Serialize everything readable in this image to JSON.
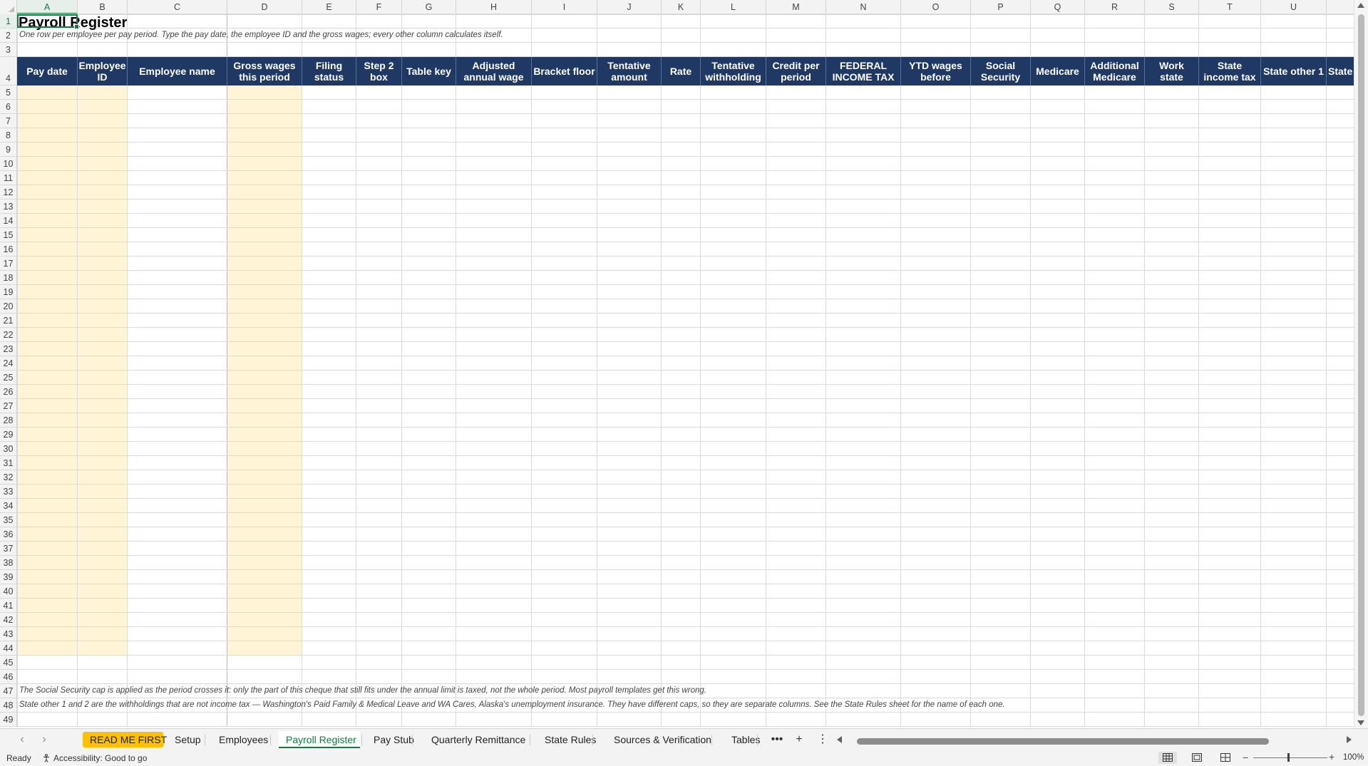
{
  "sheet": {
    "columns": [
      "A",
      "B",
      "C",
      "D",
      "E",
      "F",
      "G",
      "H",
      "I",
      "J",
      "K",
      "L",
      "M",
      "N",
      "O",
      "P",
      "Q",
      "R",
      "S",
      "T",
      "U",
      ""
    ],
    "active_column": "A",
    "rows": [
      "1",
      "2",
      "3",
      "4",
      "5",
      "6",
      "7",
      "8",
      "9",
      "10",
      "11",
      "12",
      "13",
      "14",
      "15",
      "16",
      "17",
      "18",
      "19",
      "20",
      "21",
      "22",
      "23",
      "24",
      "25",
      "26",
      "27",
      "28",
      "29",
      "30",
      "31",
      "32",
      "33",
      "34",
      "35",
      "36",
      "37",
      "38",
      "39",
      "40",
      "41",
      "42",
      "43",
      "44",
      "45",
      "46",
      "47",
      "48",
      "49"
    ],
    "active_row": "1",
    "title": "Payroll Register",
    "subtitle": "One row per employee per pay period. Type the pay date, the employee ID and the gross wages; every other column calculates itself.",
    "headers": [
      "Pay date",
      "Employee ID",
      "Employee name",
      "Gross wages this period",
      "Filing status",
      "Step 2 box",
      "Table key",
      "Adjusted annual wage",
      "Bracket floor",
      "Tentative amount",
      "Rate",
      "Tentative withholding",
      "Credit per period",
      "FEDERAL INCOME TAX",
      "YTD wages before",
      "Social Security",
      "Medicare",
      "Additional Medicare",
      "Work state",
      "State income tax",
      "State other 1",
      "State"
    ],
    "input_fill_color": "#fff5d6",
    "header_fill_color": "#1f3864",
    "note_47": "The Social Security cap is applied as the period crosses it: only the part of this cheque that still fits under the annual limit is taxed, not the whole period. Most payroll templates get this wrong.",
    "note_48": "State other 1 and 2 are the withholdings that are not income tax — Washington's Paid Family & Medical Leave and WA Cares, Alaska's unemployment insurance. They have different caps, so they are separate columns. See the State Rules sheet for the name of each one."
  },
  "tabs": {
    "items": [
      "READ ME FIRST",
      "Setup",
      "Employees",
      "Payroll Register",
      "Pay Stub",
      "Quarterly Remittance",
      "State Rules",
      "Sources & Verification",
      "Tables"
    ],
    "active": "Payroll Register",
    "special_color": "#ffc000",
    "more_icon": "ellipsis-icon",
    "add_icon": "plus-icon",
    "options_icon": "kebab-icon"
  },
  "status": {
    "ready": "Ready",
    "accessibility": "Accessibility: Good to go",
    "zoom_minus": "−",
    "zoom_plus": "+",
    "zoom": "100%"
  }
}
